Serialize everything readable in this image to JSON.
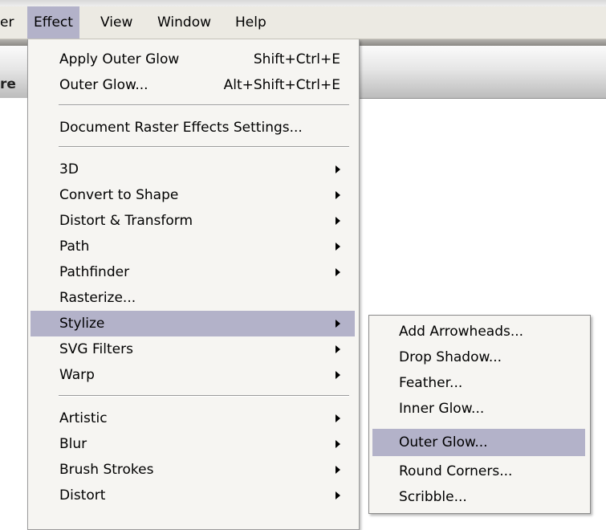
{
  "menubar": {
    "items": [
      {
        "label": "er"
      },
      {
        "label": "Effect"
      },
      {
        "label": "View"
      },
      {
        "label": "Window"
      },
      {
        "label": "Help"
      }
    ],
    "active": "Effect"
  },
  "document": {
    "title_fragment": "re"
  },
  "effect_menu": {
    "apply_outer_glow": {
      "label": "Apply Outer Glow",
      "shortcut": "Shift+Ctrl+E"
    },
    "outer_glow": {
      "label": "Outer Glow...",
      "shortcut": "Alt+Shift+Ctrl+E"
    },
    "document_raster": {
      "label": "Document Raster Effects Settings..."
    },
    "items": [
      {
        "label": "3D",
        "submenu": true
      },
      {
        "label": "Convert to Shape",
        "submenu": true
      },
      {
        "label": "Distort & Transform",
        "submenu": true
      },
      {
        "label": "Path",
        "submenu": true
      },
      {
        "label": "Pathfinder",
        "submenu": true
      },
      {
        "label": "Rasterize...",
        "submenu": false
      },
      {
        "label": "Stylize",
        "submenu": true,
        "highlighted": true
      },
      {
        "label": "SVG Filters",
        "submenu": true
      },
      {
        "label": "Warp",
        "submenu": true
      }
    ],
    "photoshop_items": [
      {
        "label": "Artistic",
        "submenu": true
      },
      {
        "label": "Blur",
        "submenu": true
      },
      {
        "label": "Brush Strokes",
        "submenu": true
      },
      {
        "label": "Distort",
        "submenu": true
      }
    ]
  },
  "stylize_submenu": {
    "items": [
      {
        "label": "Add Arrowheads..."
      },
      {
        "label": "Drop Shadow..."
      },
      {
        "label": "Feather..."
      },
      {
        "label": "Inner Glow..."
      },
      {
        "label": "Outer Glow...",
        "highlighted": true
      },
      {
        "label": "Round Corners..."
      },
      {
        "label": "Scribble..."
      }
    ]
  },
  "colors": {
    "highlight": "#b3b2c9",
    "menu_bg": "#f6f5f2",
    "menubar_bg": "#eceae3"
  }
}
